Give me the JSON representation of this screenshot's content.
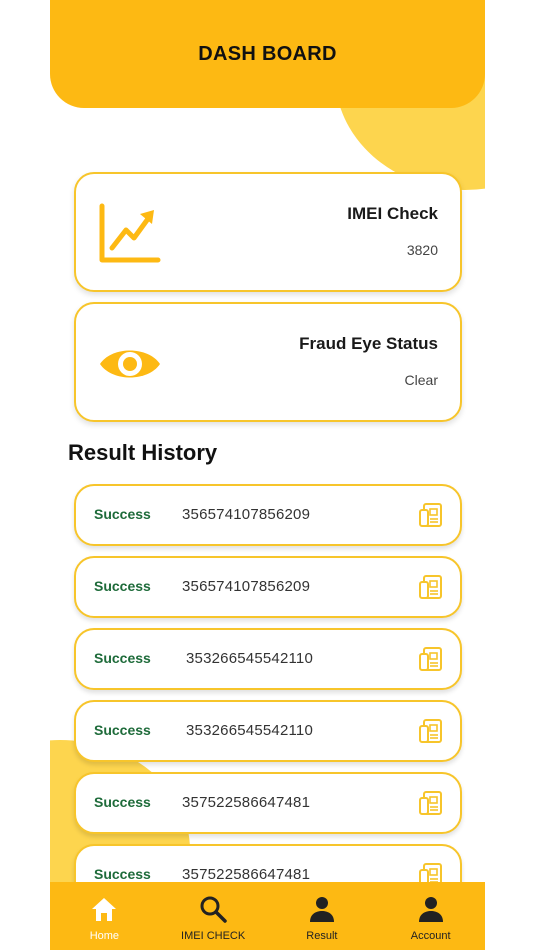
{
  "header": {
    "title": "DASH BOARD"
  },
  "cards": [
    {
      "title": "IMEI Check",
      "value": "3820",
      "icon": "chart-up-icon"
    },
    {
      "title": "Fraud Eye Status",
      "value": "Clear",
      "icon": "eye-icon"
    }
  ],
  "history": {
    "title": "Result History",
    "rows": [
      {
        "status": "Success",
        "imei": "356574107856209"
      },
      {
        "status": "Success",
        "imei": "356574107856209"
      },
      {
        "status": "Success",
        "imei": "353266545542110"
      },
      {
        "status": "Success",
        "imei": "353266545542110"
      },
      {
        "status": "Success",
        "imei": "357522586647481"
      },
      {
        "status": "Success",
        "imei": "357522586647481"
      }
    ]
  },
  "nav": {
    "items": [
      {
        "label": "Home",
        "icon": "home-icon",
        "active": true
      },
      {
        "label": "IMEI CHECK",
        "icon": "search-icon",
        "active": false
      },
      {
        "label": "Result",
        "icon": "person-icon",
        "active": false
      },
      {
        "label": "Account",
        "icon": "person-icon",
        "active": false
      }
    ]
  },
  "colors": {
    "accent": "#FDB913",
    "accent_light": "#FDD54E",
    "success": "#1E6B3A",
    "border": "#F7C52B"
  }
}
